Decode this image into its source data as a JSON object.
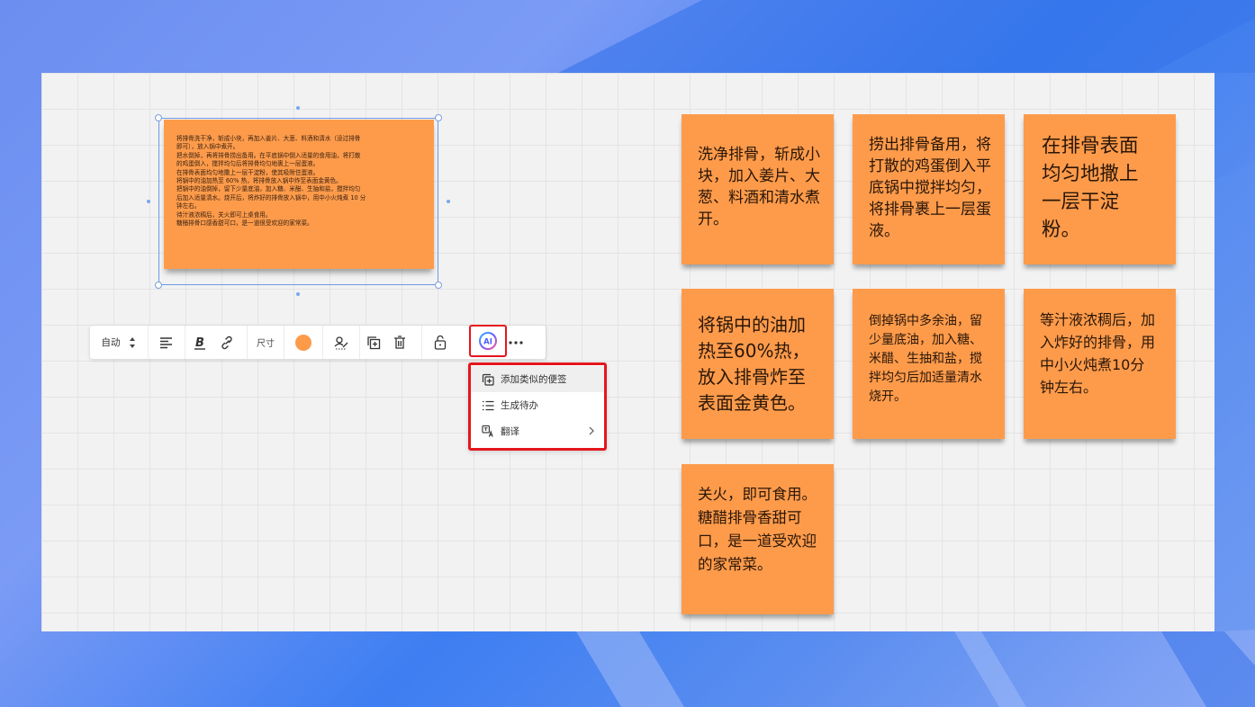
{
  "big_note": {
    "lines": [
      "将排骨洗干净，斩成小块，再加入姜片、大葱、料酒和清水（没过排骨",
      "即可），放入锅中煮开。",
      "把水倒掉，再将排骨捞出备用。在平底锅中倒入适量的食用油，将打散",
      "的鸡蛋倒入，搅拌均匀后将排骨均匀地裹上一层蛋液。",
      "在排骨表面均匀地撒上一层干淀粉，使其吸附住蛋液。",
      "将锅中的油加热至 60% 热，将排骨放入锅中炸至表面金黄色。",
      "把锅中的油倒掉，留下少量底油，加入糖、米醋、生抽和盐，搅拌均匀",
      "后加入适量清水。烧开后，将炸好的排骨放入锅中，用中小火炖煮 10 分",
      "钟左右。",
      "待汁液浓稠后，关火即可上桌食用。",
      "糖醋排骨口感香甜可口，是一道很受欢迎的家常菜。"
    ]
  },
  "notes": [
    {
      "text": "洗净排骨，斩成小块，加入姜片、大葱、料酒和清水煮开。"
    },
    {
      "text": "捞出排骨备用，将打散的鸡蛋倒入平底锅中搅拌均匀，将排骨裹上一层蛋液。"
    },
    {
      "text": "在排骨表面均匀地撒上一层干淀粉。"
    },
    {
      "text": "将锅中的油加热至60%热，放入排骨炸至表面金黄色。"
    },
    {
      "text": "倒掉锅中多余油，留少量底油，加入糖、米醋、生抽和盐，搅拌均匀后加适量清水烧开。"
    },
    {
      "text": "等汁液浓稠后，加入炸好的排骨，用中小火炖煮10分钟左右。"
    },
    {
      "text": "关火，即可食用。糖醋排骨香甜可口，是一道受欢迎的家常菜。"
    }
  ],
  "toolbar": {
    "auto_label": "自动",
    "size_label": "尺寸",
    "color": "#fd9b4b",
    "ai_label": "AI",
    "icons": [
      "stepper-icon",
      "align-left-icon",
      "bold-icon",
      "link-icon",
      "color-swatch",
      "signature-icon",
      "duplicate-icon",
      "delete-icon",
      "unlock-icon",
      "ai-icon",
      "more-icon"
    ]
  },
  "menu": {
    "items": [
      {
        "label": "添加类似的便签",
        "icon": "copy-note-icon"
      },
      {
        "label": "生成待办",
        "icon": "list-icon"
      },
      {
        "label": "翻译",
        "icon": "translate-icon"
      }
    ]
  },
  "colors": {
    "note": "#fd9b4b",
    "highlight": "#e5161d",
    "selection": "#6a9ae8"
  }
}
